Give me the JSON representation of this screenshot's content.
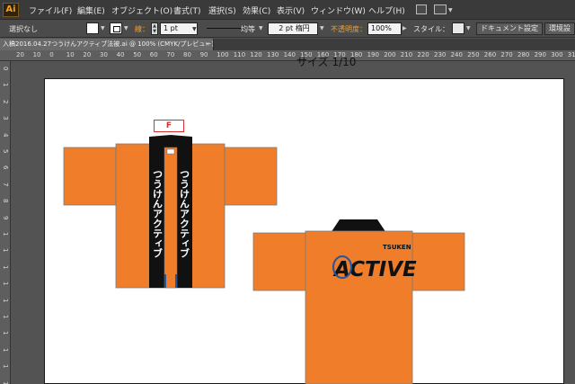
{
  "app": {
    "logo_text": "Ai"
  },
  "menu": [
    "ファイル(F)",
    "編集(E)",
    "オブジェクト(O)",
    "書式(T)",
    "選択(S)",
    "効果(C)",
    "表示(V)",
    "ウィンドウ(W)",
    "ヘルプ(H)"
  ],
  "control_bar": {
    "selection": "選択なし",
    "stroke_label": "線：",
    "stroke_weight": "1 pt",
    "stroke_profile": "均等",
    "brush": "2 pt 楕円",
    "opacity_label": "不透明度：",
    "opacity": "100%",
    "style_label": "スタイル：",
    "doc_setup": "ドキュメント設定",
    "prefs": "環境設"
  },
  "document": {
    "tab_title": "入稿2016.04.27つうけんアクティブ法被.ai @ 100% (CMYK/プレビュー)",
    "close": "×"
  },
  "ruler": {
    "top_ticks": [
      "20",
      "10",
      "0",
      "10",
      "20",
      "30",
      "40",
      "50",
      "60",
      "70",
      "80",
      "90",
      "100",
      "110",
      "120",
      "130",
      "140",
      "150",
      "160",
      "170",
      "180",
      "190",
      "200",
      "210",
      "220",
      "230",
      "240",
      "250",
      "260",
      "270",
      "280",
      "290",
      "300",
      "310"
    ],
    "left_ticks": [
      "0",
      "1",
      "2",
      "3",
      "4",
      "5",
      "6",
      "7",
      "8",
      "9",
      "1",
      "1",
      "1",
      "1",
      "1",
      "1",
      "1",
      "1",
      "1",
      "1"
    ]
  },
  "artwork": {
    "size_label": "サイズ 1/10",
    "front_label": "F",
    "collar_text": "つうけんアクティブ",
    "logo_small": "TSUKEN",
    "logo_main": "ACTIVE",
    "colors": {
      "body": "#f07d2a",
      "collar": "#111111",
      "accent": "#1e56a0"
    }
  }
}
